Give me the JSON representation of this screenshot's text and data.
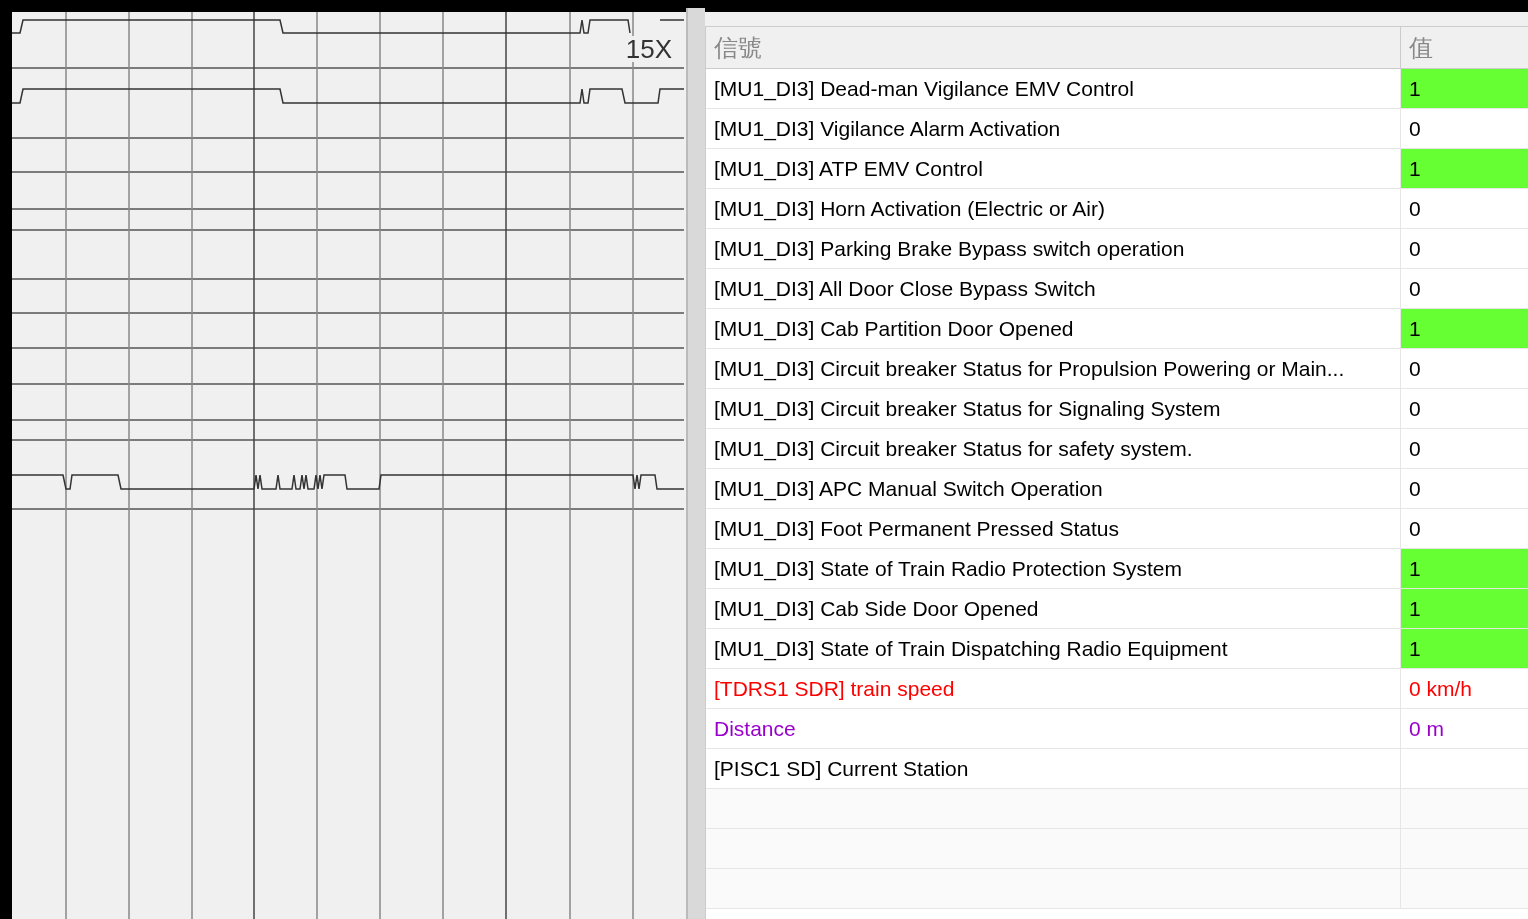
{
  "waveform": {
    "zoom_label": "15X"
  },
  "table": {
    "columns": [
      "信號",
      "值"
    ],
    "rows": [
      {
        "signal": "[MU1_DI3] Dead-man Vigilance EMV Control",
        "value": "1",
        "highlighted": true,
        "color": "#000000"
      },
      {
        "signal": "[MU1_DI3] Vigilance Alarm Activation",
        "value": "0",
        "highlighted": false,
        "color": "#000000"
      },
      {
        "signal": "[MU1_DI3] ATP EMV Control",
        "value": "1",
        "highlighted": true,
        "color": "#000000"
      },
      {
        "signal": "[MU1_DI3] Horn Activation (Electric or Air)",
        "value": "0",
        "highlighted": false,
        "color": "#000000"
      },
      {
        "signal": "[MU1_DI3] Parking Brake Bypass switch operation",
        "value": "0",
        "highlighted": false,
        "color": "#000000"
      },
      {
        "signal": "[MU1_DI3] All Door Close Bypass Switch",
        "value": "0",
        "highlighted": false,
        "color": "#000000"
      },
      {
        "signal": "[MU1_DI3] Cab Partition Door Opened",
        "value": "1",
        "highlighted": true,
        "color": "#000000"
      },
      {
        "signal": "[MU1_DI3] Circuit breaker Status for Propulsion Powering or Main...",
        "value": "0",
        "highlighted": false,
        "color": "#000000"
      },
      {
        "signal": "[MU1_DI3] Circuit breaker Status for Signaling System",
        "value": "0",
        "highlighted": false,
        "color": "#000000"
      },
      {
        "signal": "[MU1_DI3] Circuit breaker Status for safety system.",
        "value": "0",
        "highlighted": false,
        "color": "#000000"
      },
      {
        "signal": "[MU1_DI3] APC Manual Switch Operation",
        "value": "0",
        "highlighted": false,
        "color": "#000000"
      },
      {
        "signal": "[MU1_DI3] Foot Permanent Pressed Status",
        "value": "0",
        "highlighted": false,
        "color": "#000000"
      },
      {
        "signal": "[MU1_DI3] State of Train Radio Protection System",
        "value": "1",
        "highlighted": true,
        "color": "#000000"
      },
      {
        "signal": "[MU1_DI3] Cab Side Door Opened",
        "value": "1",
        "highlighted": true,
        "color": "#000000"
      },
      {
        "signal": "[MU1_DI3] State of Train Dispatching Radio Equipment",
        "value": "1",
        "highlighted": true,
        "color": "#000000"
      },
      {
        "signal": "[TDRS1 SDR] train speed",
        "value": "0 km/h",
        "highlighted": false,
        "color": "#ff0000"
      },
      {
        "signal": "Distance",
        "value": "0 m",
        "highlighted": false,
        "color": "#9900cc"
      },
      {
        "signal": "[PISC1 SD] Current Station",
        "highlighted": false,
        "color": "#000000"
      }
    ]
  }
}
